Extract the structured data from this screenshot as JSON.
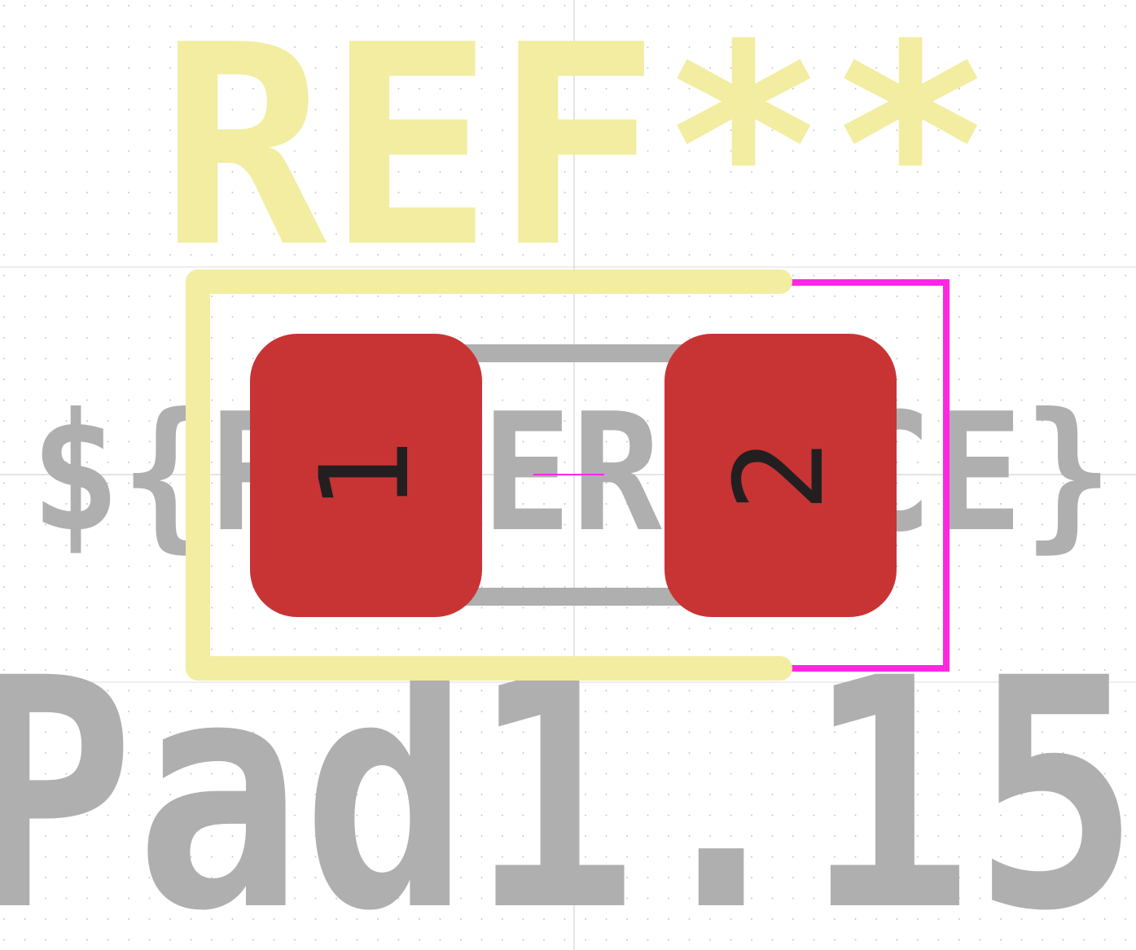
{
  "view": {
    "kind": "pcb-footprint-editor-canvas",
    "background": "#ffffff"
  },
  "footprint": {
    "reference_text": "REF**",
    "value_text": "${REFERENCE}",
    "footprint_name_fragment": "Pad1.15",
    "pads": [
      {
        "number": "1"
      },
      {
        "number": "2"
      }
    ]
  },
  "colors": {
    "silkscreen": "#f2eda1",
    "fabrication": "#afafaf",
    "pad_copper": "#c83434",
    "pad_number": "#231f20",
    "courtyard": "#ff26e2",
    "grid_dot": "#c8c8c8",
    "axis": "#c8c8c8",
    "anchor": "#ff26e2"
  },
  "layers": {
    "silkscreen": "F.SilkS",
    "fabrication": "F.Fab",
    "courtyard": "F.CrtYd",
    "copper": "F.Cu"
  },
  "icons": {
    "anchor": "crosshair-icon"
  }
}
